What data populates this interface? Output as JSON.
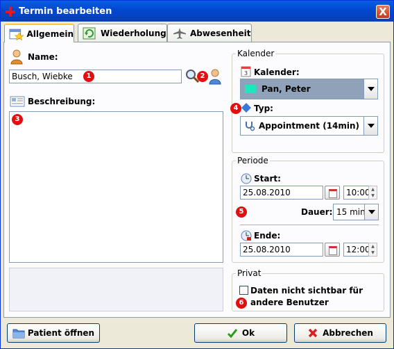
{
  "window": {
    "title": "Termin bearbeiten",
    "close_label": "X"
  },
  "tabs": [
    {
      "label": "Allgemein",
      "active": true,
      "icon": "calendar-star-icon"
    },
    {
      "label": "Wiederholung",
      "active": false,
      "icon": "recurrence-icon"
    },
    {
      "label": "Abwesenheit",
      "active": false,
      "icon": "airplane-icon"
    }
  ],
  "name": {
    "label": "Name:",
    "value": "Busch, Wiebke",
    "marker": "1",
    "search_marker": "2"
  },
  "description": {
    "label": "Beschreibung:",
    "value": "",
    "marker": "3"
  },
  "kalender_group": {
    "title": "Kalender",
    "kalender_label": "Kalender:",
    "kalender_value": "Pan, Peter",
    "kalender_color": "#1de8bd",
    "typ_label": "Typ:",
    "typ_marker": "4",
    "typ_value": "Appointment  (14min)"
  },
  "periode_group": {
    "title": "Periode",
    "start_label": "Start:",
    "start_date": "25.08.2010",
    "start_time": "10:00",
    "dauer_marker": "5",
    "dauer_label": "Dauer:",
    "dauer_value": "15 min",
    "ende_label": "Ende:",
    "ende_date": "25.08.2010",
    "ende_time": "12:00"
  },
  "privat_group": {
    "title": "Privat",
    "checkbox_label_line1": "Daten nicht sichtbar für",
    "checkbox_label_line2": "andere Benutzer",
    "checked": false,
    "marker": "6"
  },
  "footer": {
    "patient_button": "Patient öffnen",
    "ok_button": "Ok",
    "cancel_button": "Abbrechen"
  },
  "colors": {
    "accent": "#0a5fe0",
    "marker": "#e01010",
    "ok_check": "#2a9a1a",
    "cancel_x": "#d42020"
  }
}
